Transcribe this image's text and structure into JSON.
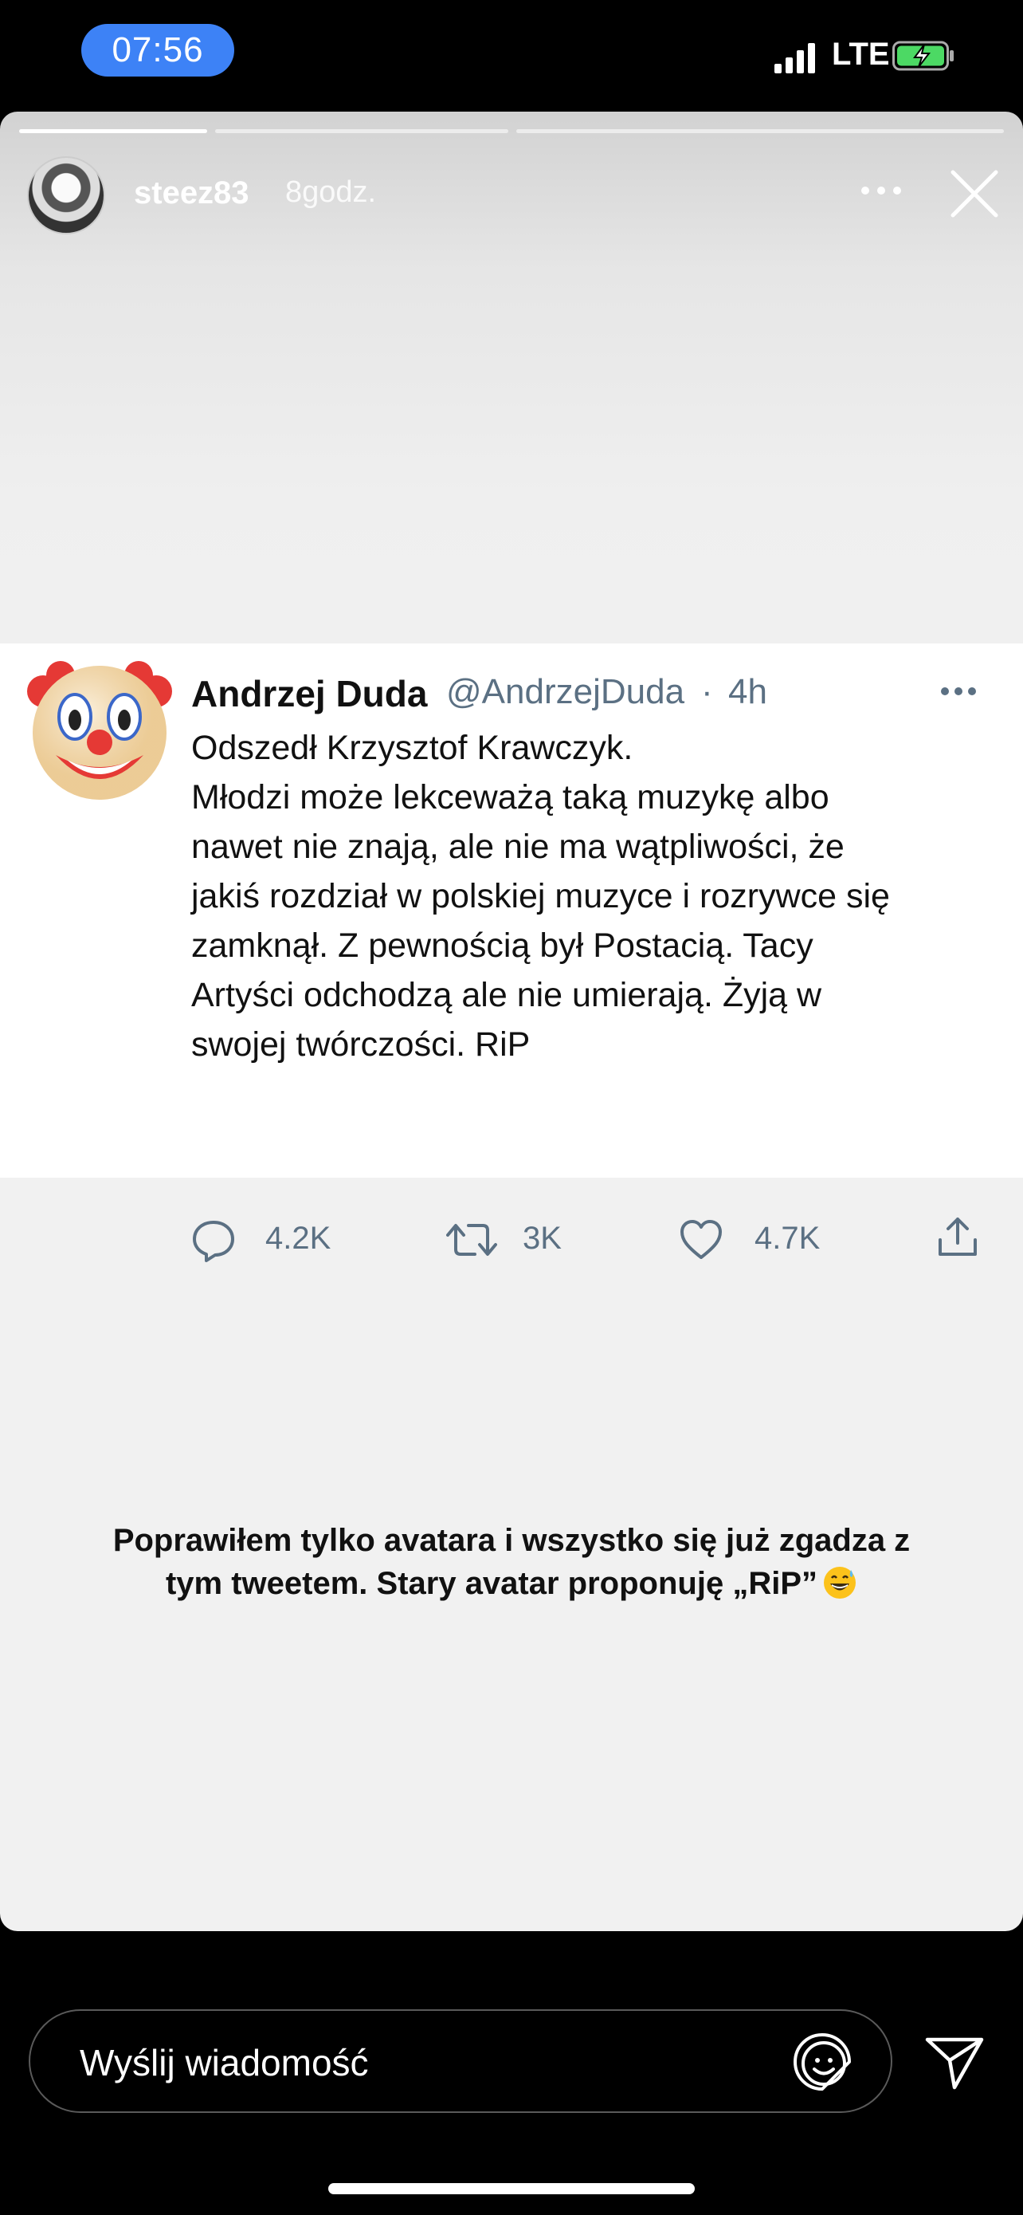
{
  "status_bar": {
    "time": "07:56",
    "network": "LTE",
    "signal_icon": "signal-icon",
    "battery_icon": "battery-charging-icon"
  },
  "story": {
    "username": "steez83",
    "time_ago": "8godz.",
    "progress_segments": 3,
    "progress_current": 1,
    "more_icon": "more-horizontal-icon",
    "close_icon": "close-icon"
  },
  "tweet": {
    "name": "Andrzej Duda",
    "handle": "@AndrzejDuda",
    "separator": "·",
    "time": "4h",
    "avatar_icon": "clown-emoji",
    "text_lines": [
      "Odszedł Krzysztof Krawczyk.",
      "Młodzi może lekceważą taką muzykę albo",
      "nawet nie znają, ale nie ma wątpliwości, że",
      "jakiś rozdział w polskiej muzyce i rozrywce się",
      "zamknął. Z pewnością był Postacią. Tacy",
      "Artyści odchodzą ale nie umierają. Żyją w",
      "swojej twórczości. RiP"
    ],
    "replies": "4.2K",
    "retweets": "3K",
    "likes": "4.7K"
  },
  "caption": {
    "line1": "Poprawiłem tylko avatara i wszystko się już zgadza z",
    "line2": "tym tweetem. Stary avatar proponuję „RiP”",
    "emoji": "grinning-sweat-emoji"
  },
  "footer": {
    "message_placeholder": "Wyślij wiadomość",
    "sticker_icon": "sticker-icon",
    "send_icon": "send-icon"
  },
  "colors": {
    "accent": "#3d82f6",
    "muted": "#5b7083"
  }
}
